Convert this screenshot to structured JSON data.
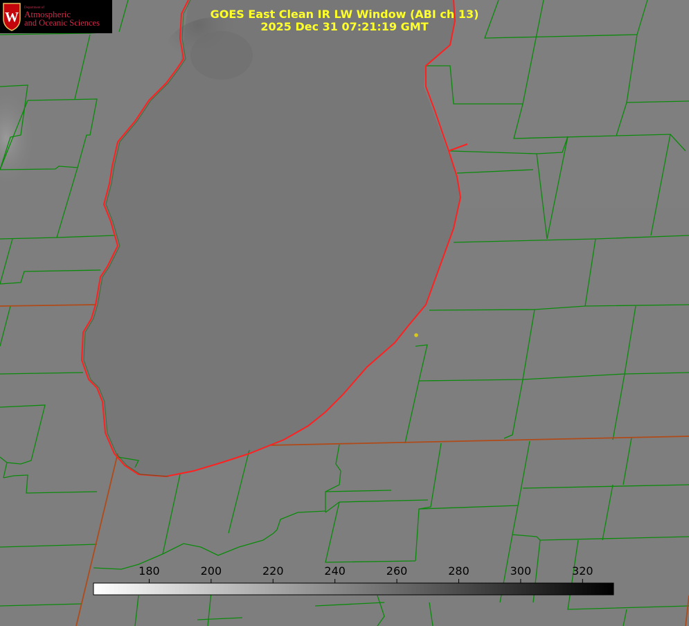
{
  "title": {
    "line1": "GOES East Clean IR LW Window (ABI ch 13)",
    "line2": "2025 Dec 31 07:21:19 GMT"
  },
  "logo": {
    "dept": "Department of",
    "line1": "Atmospheric",
    "line2": "and Oceanic Sciences",
    "icon": "uw-crest-icon"
  },
  "colors": {
    "background": "#7d7d7d",
    "lake": "#737373",
    "county_border": "#0a8a0a",
    "state_border": "#c8501e",
    "shoreline": "#ff2020",
    "title": "#ffff2a",
    "marker": "#d8c81e"
  },
  "colorbar": {
    "ticks": [
      "180",
      "200",
      "220",
      "240",
      "260",
      "280",
      "300",
      "320"
    ],
    "min_value": 162,
    "max_value": 330,
    "gradient": "white-to-black"
  }
}
